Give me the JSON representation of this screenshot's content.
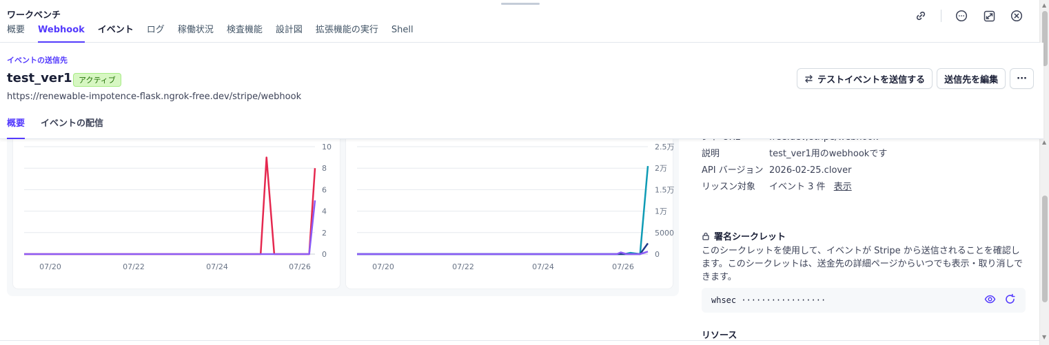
{
  "app_title": "ワークベンチ",
  "nav_tabs": [
    "概要",
    "Webhook",
    "イベント",
    "ログ",
    "稼働状況",
    "検査機能",
    "設計図",
    "拡張機能の実行",
    "Shell"
  ],
  "endpoint": {
    "kicker": "イベントの送信先",
    "name": "test_ver1",
    "status": "アクティブ",
    "url": "https://renewable-impotence-flask.ngrok-free.dev/stripe/webhook"
  },
  "actions": {
    "send_test": "テストイベントを送信する",
    "edit": "送信先を編集",
    "more": "···"
  },
  "sub_tabs": [
    "概要",
    "イベントの配信"
  ],
  "details": {
    "partial_label": "ント URL",
    "partial_value": "free.dev/stripe/webhook",
    "description_label": "説明",
    "description_value": "test_ver1用のwebhookです",
    "api_label": "API バージョン",
    "api_value": "2026-02-25.clover",
    "listen_label": "リッスン対象",
    "listen_value": "イベント 3 件",
    "listen_link": "表示"
  },
  "secret": {
    "title": "署名シークレット",
    "description": "このシークレットを使用して、イベントが Stripe から送信されることを確認します。このシークレットは、送金先の詳細ページからいつでも表示・取り消しできます。",
    "value": "whsec ·················"
  },
  "resources_title": "リソース",
  "colors": {
    "accent": "#533afd",
    "red_series": "#e5284f",
    "purple_series": "#8b5cf6",
    "teal_series": "#0e9bb5",
    "navy_series": "#1f3a8a"
  },
  "chart_data": [
    {
      "type": "line",
      "x_ticks": [
        "07/20",
        "07/22",
        "07/24",
        "07/26"
      ],
      "y_ticks": [
        "0",
        "2",
        "4",
        "6",
        "8",
        "10"
      ],
      "ylim": [
        0,
        10
      ],
      "xlim": [
        0,
        7.5
      ],
      "series": [
        {
          "color": "#e5284f",
          "points": [
            [
              0,
              0
            ],
            [
              6.1,
              0
            ],
            [
              6.25,
              9
            ],
            [
              6.45,
              0
            ],
            [
              7.35,
              0
            ],
            [
              7.5,
              8
            ]
          ]
        },
        {
          "color": "#8b5cf6",
          "points": [
            [
              0,
              0
            ],
            [
              7.35,
              0
            ],
            [
              7.5,
              5
            ]
          ]
        }
      ]
    },
    {
      "type": "line",
      "x_ticks": [
        "07/20",
        "07/22",
        "07/24",
        "07/26"
      ],
      "y_ticks": [
        "0",
        "5000",
        "1万",
        "1.5万",
        "2万",
        "2.5万"
      ],
      "ylim": [
        0,
        25000
      ],
      "xlim": [
        0,
        7.5
      ],
      "series": [
        {
          "color": "#0e9bb5",
          "points": [
            [
              0,
              0
            ],
            [
              6.9,
              0
            ],
            [
              7.05,
              300
            ],
            [
              7.3,
              0
            ],
            [
              7.5,
              20500
            ]
          ]
        },
        {
          "color": "#1f3a8a",
          "points": [
            [
              0,
              0
            ],
            [
              7.3,
              0
            ],
            [
              7.5,
              2500
            ]
          ]
        },
        {
          "color": "#8b5cf6",
          "points": [
            [
              0,
              0
            ],
            [
              6.7,
              0
            ],
            [
              6.8,
              400
            ],
            [
              6.95,
              0
            ],
            [
              7.3,
              0
            ],
            [
              7.5,
              600
            ]
          ]
        }
      ]
    }
  ]
}
